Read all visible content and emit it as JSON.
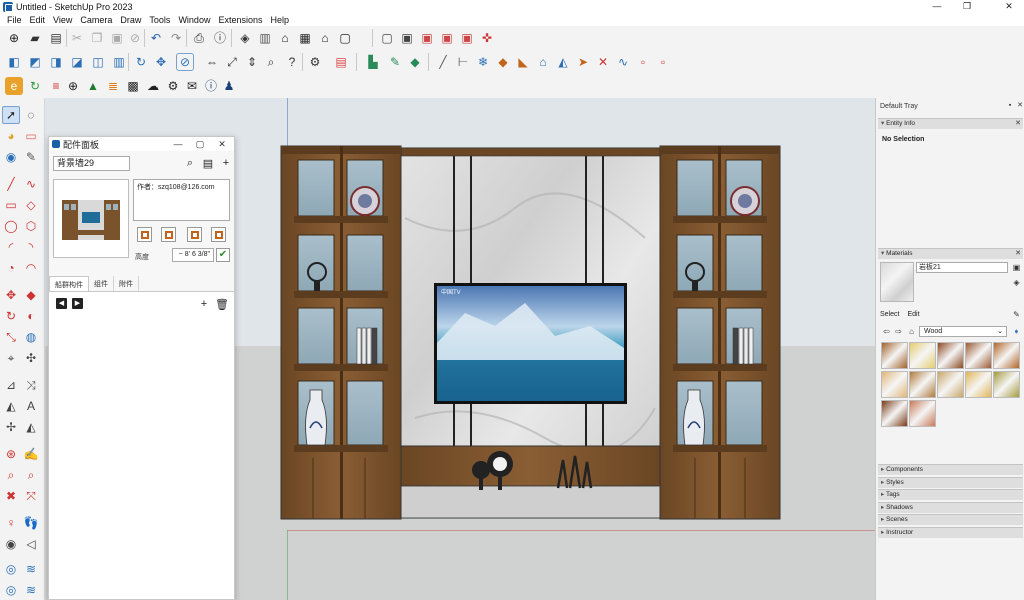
{
  "window": {
    "title": "Untitled - SketchUp Pro 2023",
    "controls": {
      "minimize": "—",
      "maximize": "❐",
      "close": "✕"
    }
  },
  "menu": [
    "File",
    "Edit",
    "View",
    "Camera",
    "Draw",
    "Tools",
    "Window",
    "Extensions",
    "Help"
  ],
  "toolbar_row1": [
    "new-file-icon",
    "open-file-icon",
    "save-icon",
    "cut-icon",
    "copy-icon",
    "paste-icon",
    "erase-icon",
    "undo-icon",
    "redo-icon",
    "print-icon",
    "model-info-icon",
    "component-icon",
    "paint-bucket-icon",
    "house-icon",
    "warehouse-icon",
    "home-outline-icon",
    "component-outline-icon",
    "style-1-icon",
    "style-2-icon",
    "style-3-icon",
    "style-4-icon",
    "style-5-icon"
  ],
  "toolbar_row2": [
    "iso-view-icon",
    "top-view-icon",
    "front-view-icon",
    "right-view-icon",
    "back-view-icon",
    "left-view-icon",
    "orbit-icon",
    "pan-icon",
    "zoom-window-icon",
    "move-icon",
    "scale-icon",
    "push-pull-icon",
    "zoom-icon",
    "help-icon",
    "settings-icon",
    "doc-icon",
    "section-plane-icon",
    "paint-icon",
    "diamond-icon",
    "pencil-icon",
    "dimension-icon",
    "sandbox-icon",
    "box-tool-icon",
    "paint-roller-icon",
    "house-tool-icon",
    "ruler-icon",
    "cross-icon",
    "wave-icon",
    "frame-icon",
    "frame2-icon"
  ],
  "toolbar_row3": [
    "plugin-e-icon",
    "refresh-icon",
    "list-icon",
    "add-circle-icon",
    "tree-icon",
    "pattern-icon",
    "chart-icon",
    "cloud-icon",
    "gear-group-icon",
    "mail-icon",
    "info-icon",
    "user-icon"
  ],
  "panel": {
    "title": "配件面板",
    "name_value": "背景墙29",
    "author": "作者：szq108@126.com",
    "height_label": "高度",
    "height_value": "~ 8' 6 3/8\"",
    "tabs": [
      "船群构件",
      "组件",
      "附件"
    ]
  },
  "tray": {
    "title": "Default Tray",
    "entity_info": "Entity Info",
    "no_selection": "No Selection",
    "materials": "Materials",
    "material_name": "岩板21",
    "select_tab": "Select",
    "edit_tab": "Edit",
    "library": "Wood",
    "sections": [
      "Components",
      "Styles",
      "Tags",
      "Shadows",
      "Scenes",
      "Instructor"
    ]
  },
  "swatch_colors": [
    "#a1622b",
    "#e3cd6f",
    "#8c4a22",
    "#9b5a34",
    "#b0662b",
    "#e0b677",
    "#b07a3b",
    "#c9a668",
    "#e2b558",
    "#a59b3e",
    "#7a3c18",
    "#c77a57"
  ],
  "tv": {
    "channel_logo": "中国TV"
  }
}
